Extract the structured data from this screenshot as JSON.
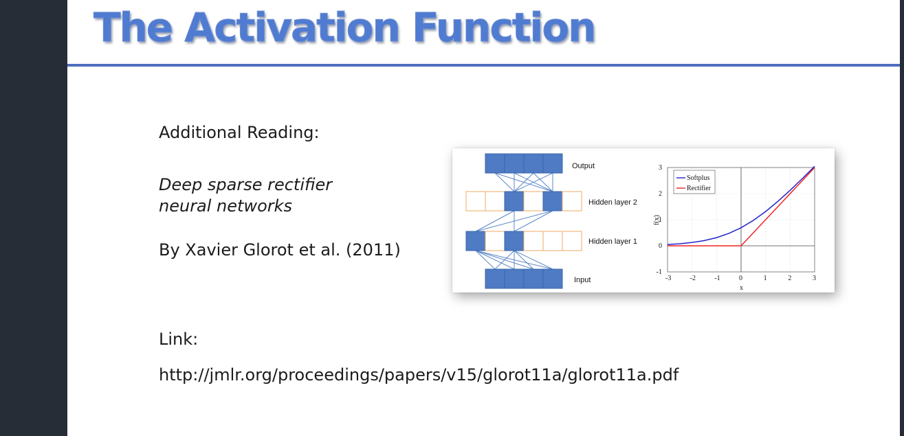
{
  "slide": {
    "title": "The Activation Function",
    "heading": "Additional Reading:",
    "paper_title_line1": "Deep sparse rectifier",
    "paper_title_line2": "neural networks",
    "author": "By Xavier Glorot et al. (2011)",
    "link_label": "Link:",
    "link_url": "http://jmlr.org/proceedings/papers/v15/glorot11a/glorot11a.pdf"
  },
  "network_diagram": {
    "layers": [
      "Output",
      "Hidden layer 2",
      "Hidden layer 1",
      "Input"
    ],
    "active_unit_color": "#4f7bc4",
    "inactive_unit_color": "#f0a860"
  },
  "chart_data": {
    "type": "line",
    "xlabel": "x",
    "ylabel": "f(x)",
    "xlim": [
      -3,
      3
    ],
    "ylim": [
      -1,
      3
    ],
    "x_ticks": [
      "-3",
      "-2",
      "-1",
      "0",
      "1",
      "2",
      "3"
    ],
    "y_ticks": [
      "-1",
      "0",
      "1",
      "2",
      "3"
    ],
    "legend_position": "top-left",
    "series": [
      {
        "name": "Softplus",
        "color": "#2222cc",
        "x": [
          -3,
          -2.5,
          -2,
          -1.5,
          -1,
          -0.5,
          0,
          0.5,
          1,
          1.5,
          2,
          2.5,
          3
        ],
        "y": [
          0.049,
          0.079,
          0.127,
          0.201,
          0.313,
          0.474,
          0.693,
          0.974,
          1.313,
          1.701,
          2.127,
          2.579,
          3.049
        ]
      },
      {
        "name": "Rectifier",
        "color": "#ee2222",
        "x": [
          -3,
          0,
          3
        ],
        "y": [
          0,
          0,
          3
        ]
      }
    ]
  }
}
